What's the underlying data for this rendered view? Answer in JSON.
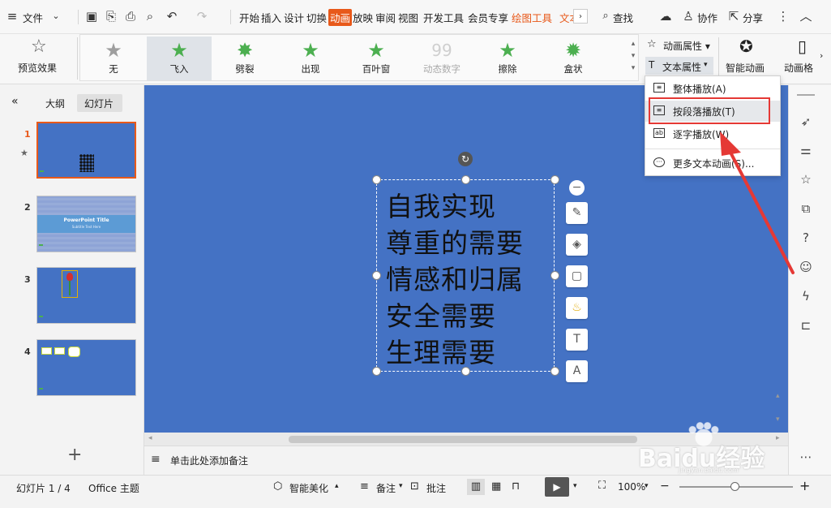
{
  "menubar": {
    "file_label": "文件",
    "tabs": [
      "开始",
      "插入",
      "设计",
      "切换",
      "动画",
      "放映",
      "审阅",
      "视图",
      "开发工具",
      "会员专享",
      "绘图工具",
      "文本"
    ],
    "active_tab": "动画",
    "search_label": "查找",
    "collab_label": "协作",
    "share_label": "分享"
  },
  "ribbon": {
    "preview_label": "预览效果",
    "effects": [
      {
        "label": "无",
        "color": "#9e9e9e"
      },
      {
        "label": "飞入",
        "color": "#4caf50"
      },
      {
        "label": "劈裂",
        "color": "#4caf50"
      },
      {
        "label": "出现",
        "color": "#4caf50"
      },
      {
        "label": "百叶窗",
        "color": "#4caf50"
      },
      {
        "label": "动态数字",
        "color": "#cfcfcf"
      },
      {
        "label": "擦除",
        "color": "#4caf50"
      },
      {
        "label": "盒状",
        "color": "#4caf50"
      }
    ],
    "selected_effect": "飞入",
    "anim_props_label": "动画属性",
    "text_props_label": "文本属性",
    "smart_anim_label": "智能动画",
    "anim_pane_label": "动画格"
  },
  "dropdown": {
    "items": [
      "整体播放(A)",
      "按段落播放(T)",
      "逐字播放(W)",
      "更多文本动画(S)..."
    ]
  },
  "leftpanel": {
    "tab_outline": "大纲",
    "tab_slides": "幻灯片",
    "thumb2_title": "PowerPoint Title",
    "thumb2_sub": "Subtitle Text Here",
    "slide_numbers": [
      "1",
      "2",
      "3",
      "4"
    ]
  },
  "slide": {
    "lines": [
      "自我实现",
      "尊重的需要",
      "情感和归属",
      "安全需要",
      "生理需要"
    ]
  },
  "notes": {
    "placeholder": "单击此处添加备注"
  },
  "status": {
    "slide_info": "幻灯片 1 / 4",
    "theme": "Office 主题",
    "smart_beautify": "智能美化",
    "notes_label": "备注",
    "comment_label": "批注",
    "zoom": "100%"
  },
  "colors": {
    "slide_bg": "#4472c4",
    "accent": "#e8591a",
    "annotation": "#e53935"
  },
  "watermark": {
    "text": "Baidu经验",
    "sub": "jingyan.baidu.com"
  }
}
